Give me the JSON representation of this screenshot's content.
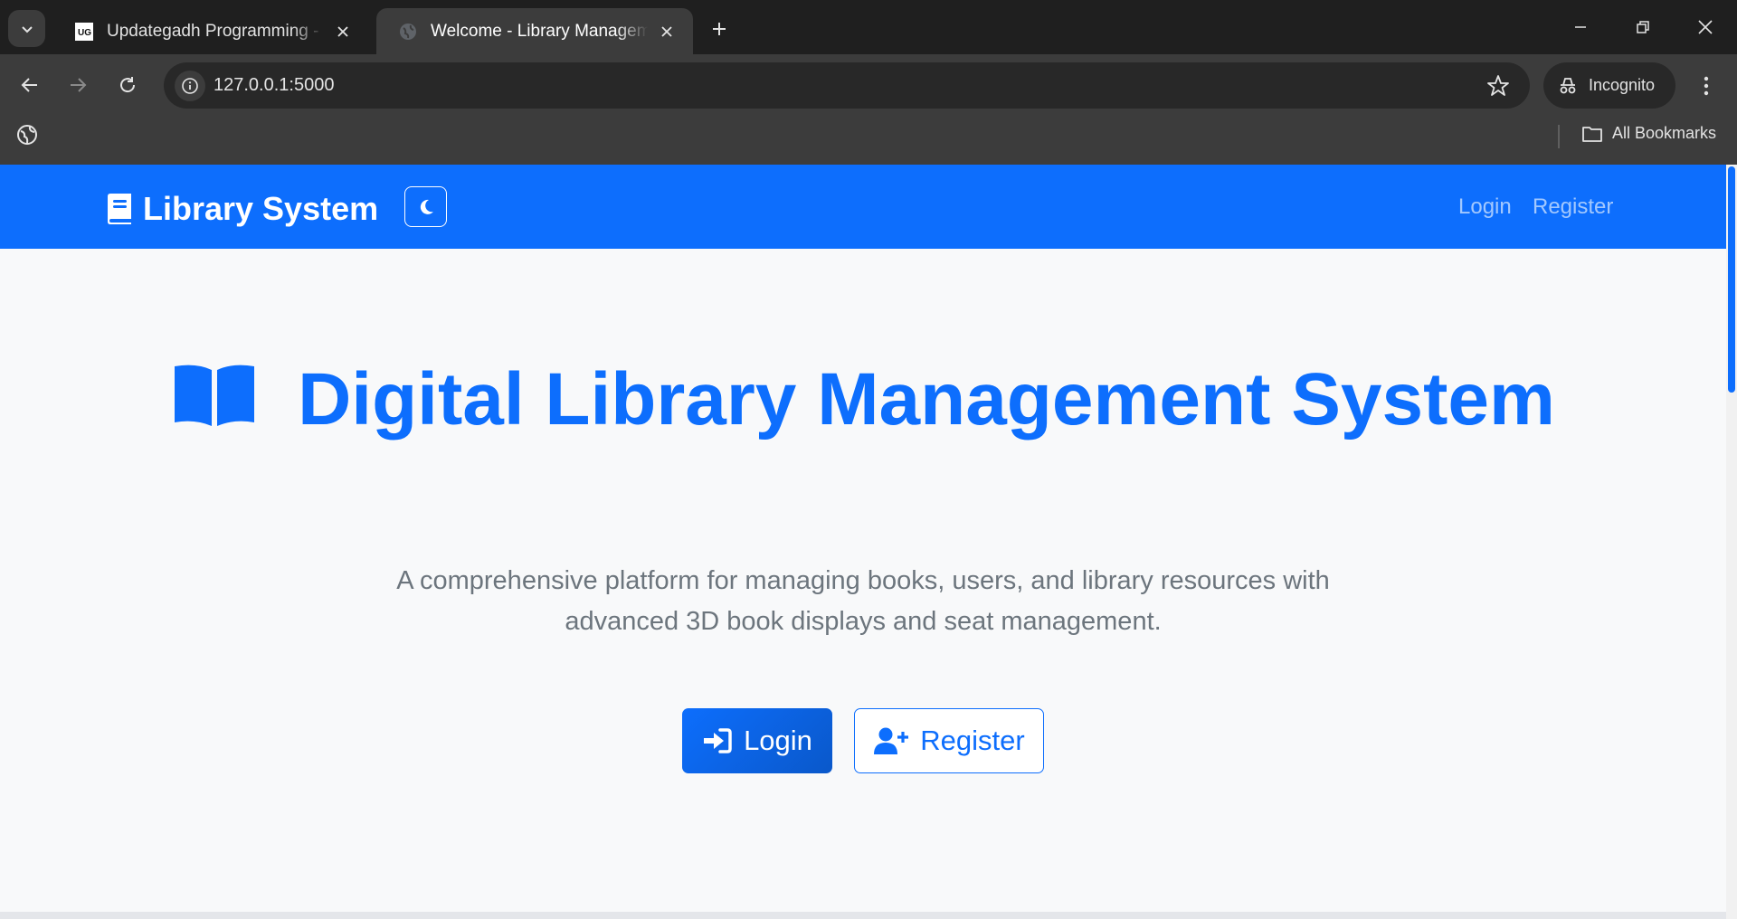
{
  "browser": {
    "tabs": [
      {
        "title": "Updategadh Programming - Up",
        "favicon": "ug-logo-icon",
        "active": false
      },
      {
        "title": "Welcome - Library Management",
        "favicon": "globe-icon",
        "active": true
      }
    ],
    "address": "127.0.0.1:5000",
    "profile_label": "Incognito",
    "bookmarks_label": "All Bookmarks"
  },
  "navbar": {
    "brand": "Library System",
    "links": {
      "login": "Login",
      "register": "Register"
    },
    "theme_toggle_icon": "moon-icon"
  },
  "hero": {
    "title": "Digital Library Management System",
    "subtitle": "A comprehensive platform for managing books, users, and library resources with advanced 3D book displays and seat management.",
    "login_label": "Login",
    "register_label": "Register"
  },
  "colors": {
    "primary": "#0d6efd",
    "muted_text": "#6c757d",
    "page_bg": "#f8f9fa",
    "chrome_dark": "#1f1f1f",
    "chrome_toolbar": "#3c3c3c"
  }
}
